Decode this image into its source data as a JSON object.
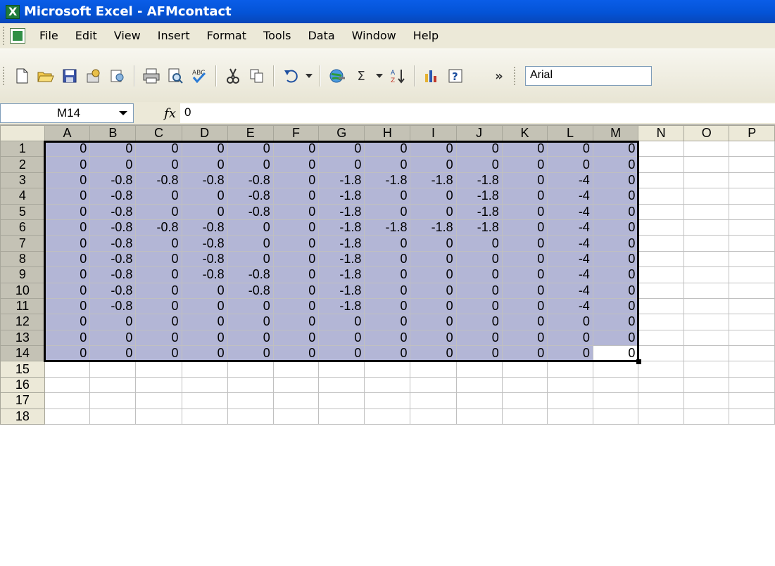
{
  "window": {
    "title": "Microsoft Excel - AFMcontact"
  },
  "menu": [
    "File",
    "Edit",
    "View",
    "Insert",
    "Format",
    "Tools",
    "Data",
    "Window",
    "Help"
  ],
  "toolbar": {
    "font_name": "Arial",
    "buttons": [
      "new-icon",
      "open-icon",
      "save-icon",
      "permission-icon",
      "research-icon",
      "print-icon",
      "print-preview-icon",
      "spelling-icon",
      "cut-icon",
      "copy-icon",
      "undo-icon",
      "hyperlink-icon",
      "autosum-icon",
      "sort-ascending-icon",
      "chart-wizard-icon",
      "help-icon"
    ],
    "sum_glyph": "Σ",
    "more_glyph": "»"
  },
  "formula_bar": {
    "name_box": "M14",
    "fx": "fx",
    "value": "0"
  },
  "sheet": {
    "columns": [
      "A",
      "B",
      "C",
      "D",
      "E",
      "F",
      "G",
      "H",
      "I",
      "J",
      "K",
      "L",
      "M",
      "N",
      "O",
      "P"
    ],
    "rows": [
      [
        "0",
        "0",
        "0",
        "0",
        "0",
        "0",
        "0",
        "0",
        "0",
        "0",
        "0",
        "0",
        "0"
      ],
      [
        "0",
        "0",
        "0",
        "0",
        "0",
        "0",
        "0",
        "0",
        "0",
        "0",
        "0",
        "0",
        "0"
      ],
      [
        "0",
        "-0.8",
        "-0.8",
        "-0.8",
        "-0.8",
        "0",
        "-1.8",
        "-1.8",
        "-1.8",
        "-1.8",
        "0",
        "-4",
        "0"
      ],
      [
        "0",
        "-0.8",
        "0",
        "0",
        "-0.8",
        "0",
        "-1.8",
        "0",
        "0",
        "-1.8",
        "0",
        "-4",
        "0"
      ],
      [
        "0",
        "-0.8",
        "0",
        "0",
        "-0.8",
        "0",
        "-1.8",
        "0",
        "0",
        "-1.8",
        "0",
        "-4",
        "0"
      ],
      [
        "0",
        "-0.8",
        "-0.8",
        "-0.8",
        "0",
        "0",
        "-1.8",
        "-1.8",
        "-1.8",
        "-1.8",
        "0",
        "-4",
        "0"
      ],
      [
        "0",
        "-0.8",
        "0",
        "-0.8",
        "0",
        "0",
        "-1.8",
        "0",
        "0",
        "0",
        "0",
        "-4",
        "0"
      ],
      [
        "0",
        "-0.8",
        "0",
        "-0.8",
        "0",
        "0",
        "-1.8",
        "0",
        "0",
        "0",
        "0",
        "-4",
        "0"
      ],
      [
        "0",
        "-0.8",
        "0",
        "-0.8",
        "-0.8",
        "0",
        "-1.8",
        "0",
        "0",
        "0",
        "0",
        "-4",
        "0"
      ],
      [
        "0",
        "-0.8",
        "0",
        "0",
        "-0.8",
        "0",
        "-1.8",
        "0",
        "0",
        "0",
        "0",
        "-4",
        "0"
      ],
      [
        "0",
        "-0.8",
        "0",
        "0",
        "0",
        "0",
        "-1.8",
        "0",
        "0",
        "0",
        "0",
        "-4",
        "0"
      ],
      [
        "0",
        "0",
        "0",
        "0",
        "0",
        "0",
        "0",
        "0",
        "0",
        "0",
        "0",
        "0",
        "0"
      ],
      [
        "0",
        "0",
        "0",
        "0",
        "0",
        "0",
        "0",
        "0",
        "0",
        "0",
        "0",
        "0",
        "0"
      ],
      [
        "0",
        "0",
        "0",
        "0",
        "0",
        "0",
        "0",
        "0",
        "0",
        "0",
        "0",
        "0",
        "0"
      ]
    ],
    "row_labels": [
      "1",
      "2",
      "3",
      "4",
      "5",
      "6",
      "7",
      "8",
      "9",
      "10",
      "11",
      "12",
      "13",
      "14",
      "15",
      "16",
      "17",
      "18"
    ],
    "active_cell": "M14"
  }
}
